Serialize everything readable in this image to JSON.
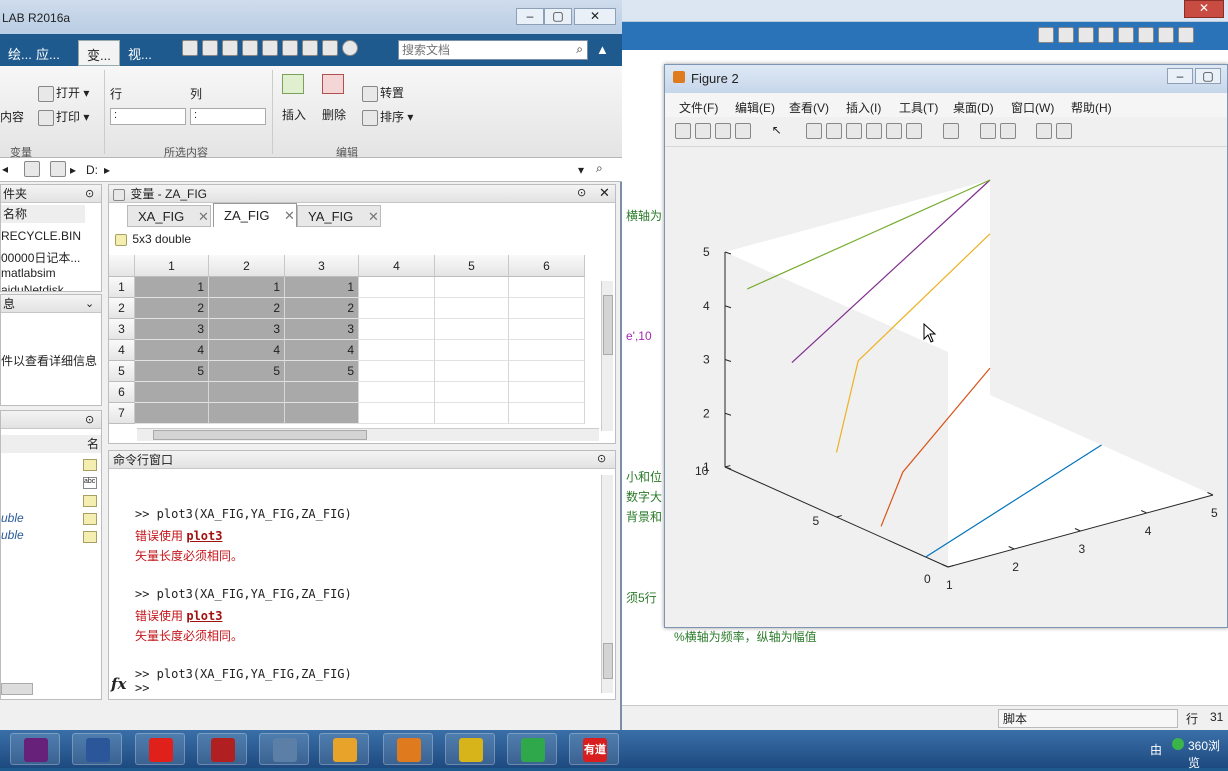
{
  "main_window": {
    "title": "LAB R2016a",
    "tabs": [
      "绘...",
      "应...",
      "变...",
      "视..."
    ],
    "search_placeholder": "搜索文档",
    "ribbon": {
      "new_from_selection": "内容",
      "open": "打开",
      "print": "打印",
      "row_label": "行",
      "col_label": "列",
      "row_value": ":",
      "col_value": ":",
      "insert": "插入",
      "delete": "删除",
      "transpose": "转置",
      "sort": "排序",
      "group_variable": "变量",
      "group_selection": "所选内容",
      "group_edit": "编辑"
    },
    "address": "D:",
    "folder_panel": {
      "title": "件夹",
      "col_header": "名称",
      "items": [
        "RECYCLE.BIN",
        "00000日记本...",
        "matlabsim",
        "aiduNetdisk"
      ]
    },
    "details_panel": {
      "title": "息",
      "hint": "件以查看详细信息"
    },
    "workspace_panel": {
      "col_header": "名",
      "items": [
        "uble",
        "uble"
      ]
    }
  },
  "variable_editor": {
    "title": "变量 - ZA_FIG",
    "tabs": [
      "XA_FIG",
      "ZA_FIG",
      "YA_FIG"
    ],
    "active_tab": "ZA_FIG",
    "size_label": "5x3 double",
    "columns": [
      "1",
      "2",
      "3",
      "4",
      "5",
      "6"
    ],
    "row_numbers": [
      "1",
      "2",
      "3",
      "4",
      "5",
      "6",
      "7"
    ],
    "rows": [
      [
        "1",
        "1",
        "1"
      ],
      [
        "2",
        "2",
        "2"
      ],
      [
        "3",
        "3",
        "3"
      ],
      [
        "4",
        "4",
        "4"
      ],
      [
        "5",
        "5",
        "5"
      ],
      [
        "",
        "",
        ""
      ],
      [
        "",
        "",
        ""
      ]
    ]
  },
  "command_window": {
    "title": "命令行窗口",
    "lines": [
      {
        "type": "cmd",
        "text": ">> plot3(XA_FIG,YA_FIG,ZA_FIG)"
      },
      {
        "type": "err",
        "text": "错误使用 ",
        "link": "plot3"
      },
      {
        "type": "err2",
        "text": "矢量长度必须相同。"
      },
      {
        "type": "cmd",
        "text": ">> plot3(XA_FIG,YA_FIG,ZA_FIG)"
      },
      {
        "type": "err",
        "text": "错误使用 ",
        "link": "plot3"
      },
      {
        "type": "err2",
        "text": "矢量长度必须相同。"
      },
      {
        "type": "cmd",
        "text": ">> plot3(XA_FIG,YA_FIG,ZA_FIG)"
      }
    ],
    "prompt": ">>",
    "fx": "fx"
  },
  "background_editor": {
    "snippets": [
      "横轴为",
      "e',10",
      "小和位",
      "数字大",
      "背景和",
      "须5行",
      "%横轴为频率，纵轴为幅值"
    ],
    "status_script": "脚本",
    "status_row": "行",
    "status_row_value": "31"
  },
  "figure": {
    "title": "Figure 2",
    "menus": [
      "文件(F)",
      "编辑(E)",
      "查看(V)",
      "插入(I)",
      "工具(T)",
      "桌面(D)",
      "窗口(W)",
      "帮助(H)"
    ]
  },
  "chart_data": {
    "type": "line",
    "title": "",
    "xlabel": "",
    "ylabel": "",
    "zlabel": "",
    "x_ticks": [
      "1",
      "2",
      "3",
      "4",
      "5"
    ],
    "y_ticks": [
      "0",
      "5",
      "10"
    ],
    "z_ticks": [
      "1",
      "2",
      "3",
      "4",
      "5"
    ],
    "xlim": [
      1,
      5
    ],
    "ylim": [
      0,
      10
    ],
    "zlim": [
      1,
      5
    ],
    "grid": false,
    "series": [
      {
        "color": "#0072bd",
        "x": [
          1,
          5
        ],
        "y": [
          1,
          5
        ],
        "z": [
          1,
          1
        ]
      },
      {
        "color": "#d95319",
        "x": [
          1,
          2,
          5
        ],
        "y": [
          3,
          5,
          10
        ],
        "z": [
          1.2,
          1.5,
          1.5
        ]
      },
      {
        "color": "#edb120",
        "x": [
          1,
          2,
          5
        ],
        "y": [
          5,
          7,
          10
        ],
        "z": [
          2.2,
          3.2,
          4
        ]
      },
      {
        "color": "#7e2f8e",
        "x": [
          1,
          5
        ],
        "y": [
          7,
          10
        ],
        "z": [
          3.5,
          5
        ]
      },
      {
        "color": "#77ac30",
        "x": [
          1,
          5
        ],
        "y": [
          9,
          10
        ],
        "z": [
          4.5,
          5
        ]
      }
    ]
  },
  "taskbar": {
    "tray_text": "由",
    "browser_label": "360浏览",
    "apps": [
      {
        "name": "visual-studio",
        "color": "#68217a"
      },
      {
        "name": "word",
        "color": "#2b579a"
      },
      {
        "name": "acrobat",
        "color": "#e0201b"
      },
      {
        "name": "media",
        "color": "#b02020"
      },
      {
        "name": "window-app",
        "color": "#5b7fa6"
      },
      {
        "name": "matlab",
        "color": "#e8a32a"
      },
      {
        "name": "search",
        "color": "#e07a1f"
      },
      {
        "name": "ultraedit",
        "color": "#d6b41a"
      },
      {
        "name": "360",
        "color": "#2ea84a"
      },
      {
        "name": "youdao",
        "color": "#d81e1e"
      }
    ],
    "youdao_text": "有道"
  }
}
